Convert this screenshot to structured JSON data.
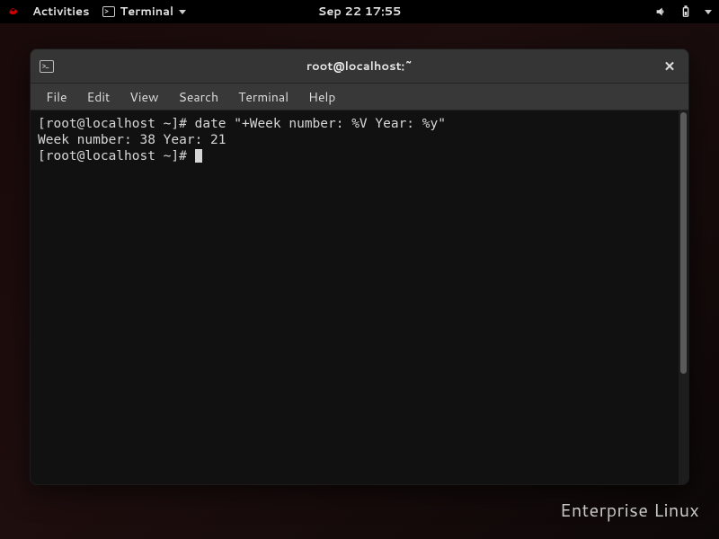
{
  "topbar": {
    "activities": "Activities",
    "app_name": "Terminal",
    "clock": "Sep 22  17:55"
  },
  "window": {
    "title": "root@localhost:~"
  },
  "menubar": {
    "file": "File",
    "edit": "Edit",
    "view": "View",
    "search": "Search",
    "terminal": "Terminal",
    "help": "Help"
  },
  "terminal": {
    "line1_prompt": "[root@localhost ~]# ",
    "line1_cmd": "date \"+Week number: %V Year: %y\"",
    "line2": "Week number: 38 Year: 21",
    "line3_prompt": "[root@localhost ~]# "
  },
  "brand": "Enterprise Linux"
}
